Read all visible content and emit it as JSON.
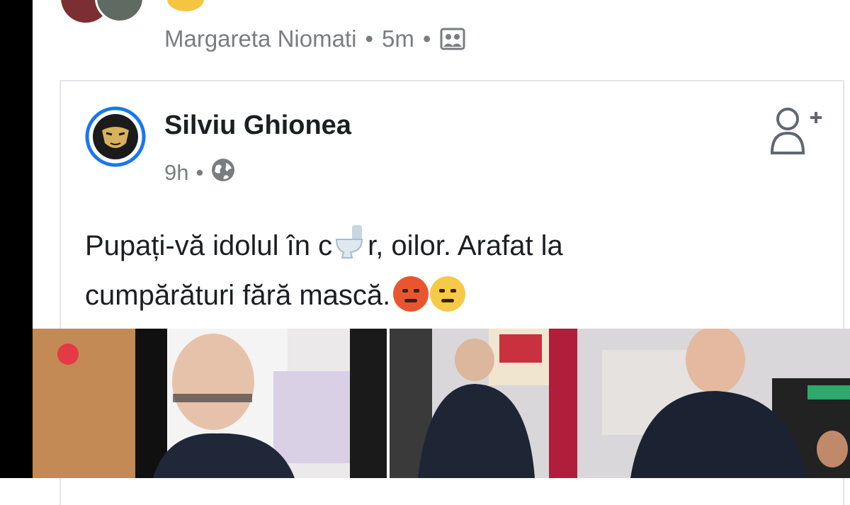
{
  "shared_by": {
    "name": "Margareta Niomati",
    "time": "5m",
    "audience_icon": "friends-icon"
  },
  "post": {
    "author": "Silviu Ghionea",
    "time": "9h",
    "audience_icon": "globe-icon",
    "text_line1_a": "Pupați-vă idolul în c",
    "text_line1_b": "r, oilor. Arafat la",
    "text_line2": "cumpărături fără mască.",
    "inline_icons": [
      "toilet-emoji",
      "angry-face-emoji",
      "smirk-face-emoji"
    ],
    "add_friend_icon": "add-friend-icon"
  },
  "colors": {
    "text": "#1c1e21",
    "meta": "#7a7d80",
    "avatar_ring": "#1877f2"
  }
}
